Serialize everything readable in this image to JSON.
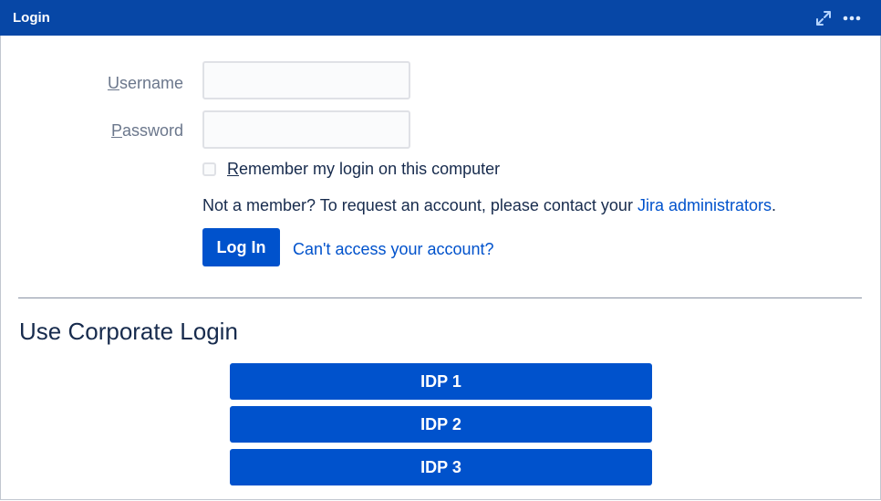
{
  "window": {
    "title": "Login",
    "icons": [
      "expand-icon",
      "more-icon"
    ]
  },
  "form": {
    "username_label_first": "U",
    "username_label_rest": "sername",
    "username_value": "",
    "password_label_first": "P",
    "password_label_rest": "assword",
    "password_value": "",
    "remember_first": "R",
    "remember_rest": "emember my login on this computer",
    "remember_checked": false,
    "member_text": "Not a member? To request an account, please contact your ",
    "member_link": "Jira administrators",
    "member_suffix": ".",
    "login_button": "Log In",
    "cant_access_link": "Can't access your account?"
  },
  "corporate": {
    "title": "Use Corporate Login",
    "providers": [
      "IDP 1",
      "IDP 2",
      "IDP 3"
    ]
  },
  "colors": {
    "titlebar": "#0747a6",
    "primary_button": "#0052cc",
    "link": "#0052cc",
    "text": "#172b4d",
    "label": "#6b778c"
  }
}
